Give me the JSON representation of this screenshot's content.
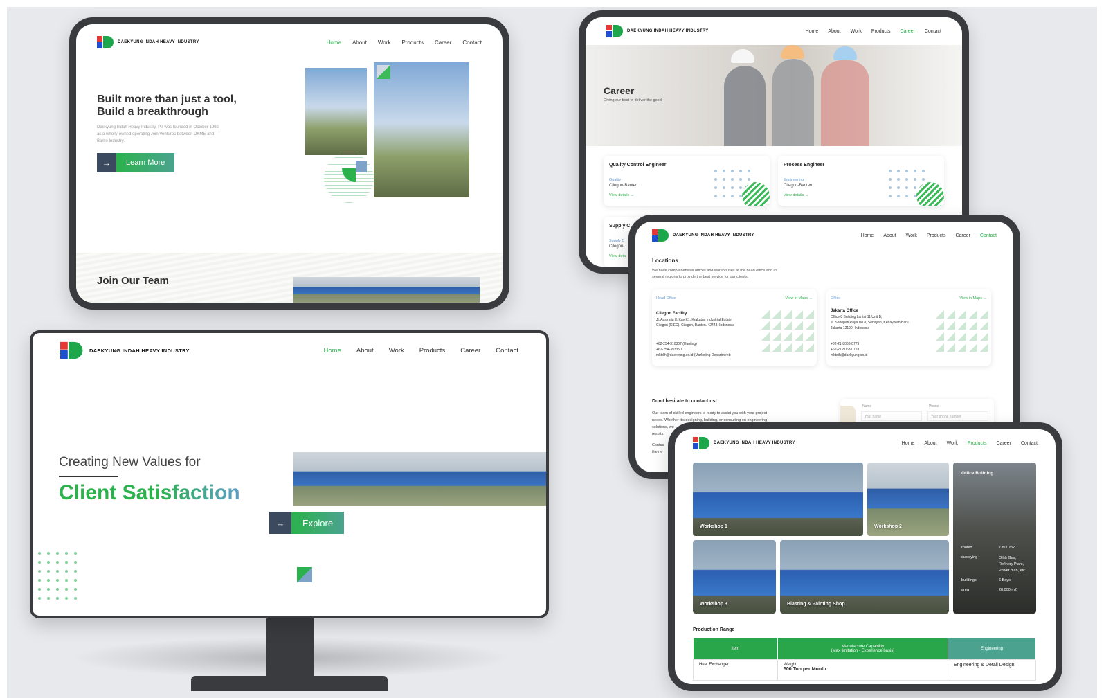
{
  "brand": {
    "name": "DAEKYUNG INDAH HEAVY INDUSTRY"
  },
  "nav": {
    "home": "Home",
    "about": "About",
    "work": "Work",
    "products": "Products",
    "career": "Career",
    "contact": "Contact"
  },
  "tablet_home": {
    "hero_line1": "Built more than just a tool,",
    "hero_line2": "Build a breakthrough",
    "hero_body": "Daekyung Indah Heavy Industry, PT was founded in October 1992, as a wholly-owned operating Join Ventures between DKME and Barito Industry.",
    "learn_more": "Learn More",
    "join_title": "Join Our Team"
  },
  "monitor": {
    "creating": "Creating New Values for",
    "client": "Client Satisfaction",
    "explore": "Explore"
  },
  "career": {
    "title": "Career",
    "subtitle": "Giving our best to deliver the good",
    "jobs": [
      {
        "title": "Quality Control Engineer",
        "dept": "Quality",
        "loc": "Cilegon-Banten",
        "link": "View details →"
      },
      {
        "title": "Process Engineer",
        "dept": "Engineering",
        "loc": "Cilegon-Banten",
        "link": "View details →"
      }
    ],
    "partial_title": "Supply C",
    "partial_dept": "Supply C",
    "partial_loc": "Cilegon-",
    "partial_link": "View deta"
  },
  "contact": {
    "locations_title": "Locations",
    "locations_desc_1": "We have comprehensive offices and warehouses at the head office and in",
    "locations_desc_2": "several regions to provide the best service for our clients.",
    "head": {
      "tag": "Head Office",
      "maps": "View in Maps →",
      "name": "Cilegon Facility",
      "addr1": "Jl. Australia II, Kav K1, Krakatau Industrial Estate",
      "addr2": "Cilegon (KIEC), Cilegon, Banten. 42443. Indonesia",
      "phone1": "+62-254-310307 (Hunting)",
      "phone2": "+62-254-393350",
      "email": "mktdih@daekyung.co.id (Marketing Department)"
    },
    "office": {
      "tag": "Office",
      "maps": "View in Maps →",
      "name": "Jakarta Office",
      "addr1": "Office 8 Building Lantai 11 Unit B,",
      "addr2": "Jl. Senopati Raya No.8, Senayan, Kebayoran Baru",
      "addr3": "Jakarta 12190, Indonesia",
      "phone1": "+62-21-8063-0779",
      "phone2": "+62-21-8063-0778",
      "email": "mktdih@daekyung.co.id"
    },
    "cta_title": "Don't hesitate to contact us!",
    "cta_l1": "Our team of skilled engineers is ready to assist you with your project",
    "cta_l2": "needs. Whether it's designing, building, or consulting on engineering",
    "cta_l3": "solutions, we",
    "cta_l4": "results.",
    "cta_l5": "Contac",
    "cta_l6": "the ne",
    "form_name_label": "Name",
    "form_name_ph": "Your name",
    "form_phone_label": "Phone",
    "form_phone_ph": "Your phone number"
  },
  "products": {
    "tiles": [
      "Workshop 1",
      "Workshop 2",
      "Workshop 3",
      "Blasting & Painting Shop"
    ],
    "office": {
      "title": "Office Building",
      "rows": [
        {
          "k": "roofed",
          "v": "7.800 m2"
        },
        {
          "k": "supplying",
          "v": "Oil & Gas, Refinery Plant, Power plan, etc."
        },
        {
          "k": "buildings",
          "v": "6 Bays"
        },
        {
          "k": "area",
          "v": "28.000 m2"
        }
      ]
    },
    "range_title": "Production Range",
    "col_item": "Item",
    "col_cap1": "Manufacture Capability",
    "col_cap2": "(Max limitation - Experience basis)",
    "col_eng": "Engineering",
    "row_item": "Heat Exchanger",
    "row_weight_label": "Weight",
    "row_weight_val": "500 Ton per Month",
    "row_eng": "Engineering & Detail Design"
  },
  "colors": {
    "accent": "#2bb24c",
    "dark": "#3b4a5e",
    "frame": "#3a3b3f",
    "bg": "#e8e9ec"
  }
}
